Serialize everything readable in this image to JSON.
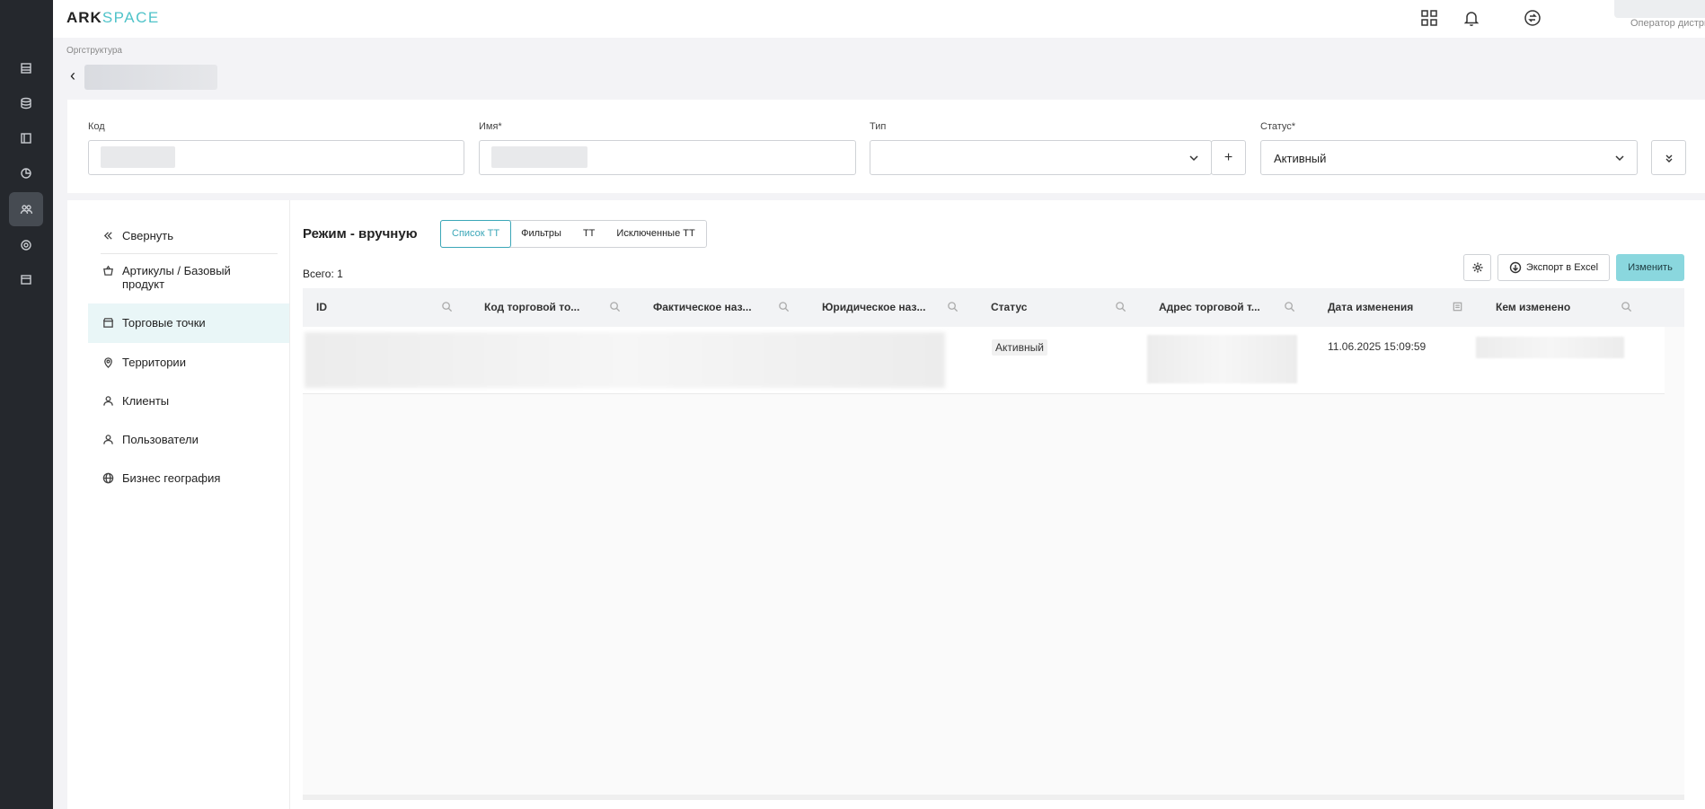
{
  "app": {
    "logo_part1": "ARK",
    "logo_part2": "SPACE"
  },
  "user": {
    "role": "Оператор дистрибу..."
  },
  "breadcrumb": "Оргструктура",
  "form": {
    "code_label": "Код",
    "name_label": "Имя*",
    "type_label": "Тип",
    "status_label": "Статус*",
    "status_value": "Активный",
    "add_button": "+"
  },
  "sidebar": {
    "collapse_label": "Свернуть",
    "items": [
      {
        "label": "Артикулы / Базовый продукт",
        "icon": "basket-icon"
      },
      {
        "label": "Торговые точки",
        "icon": "store-icon"
      },
      {
        "label": "Территории",
        "icon": "location-pin-icon"
      },
      {
        "label": "Клиенты",
        "icon": "person-icon"
      },
      {
        "label": "Пользователи",
        "icon": "person-icon"
      },
      {
        "label": "Бизнес география",
        "icon": "globe-icon"
      }
    ]
  },
  "main": {
    "mode_title": "Режим - вручную",
    "tabs": [
      "Список ТТ",
      "Фильтры",
      "ТТ",
      "Исключенные ТТ"
    ],
    "total": "Всего: 1",
    "export_label": "Экспорт в Excel",
    "edit_label": "Изменить"
  },
  "table": {
    "columns": [
      "ID",
      "Код торговой то...",
      "Фактическое наз...",
      "Юридическое наз...",
      "Статус",
      "Адрес торговой т...",
      "Дата изменения",
      "Кем изменено"
    ],
    "rows": [
      {
        "status": "Активный",
        "date": "11.06.2025 15:09:59"
      }
    ]
  }
}
